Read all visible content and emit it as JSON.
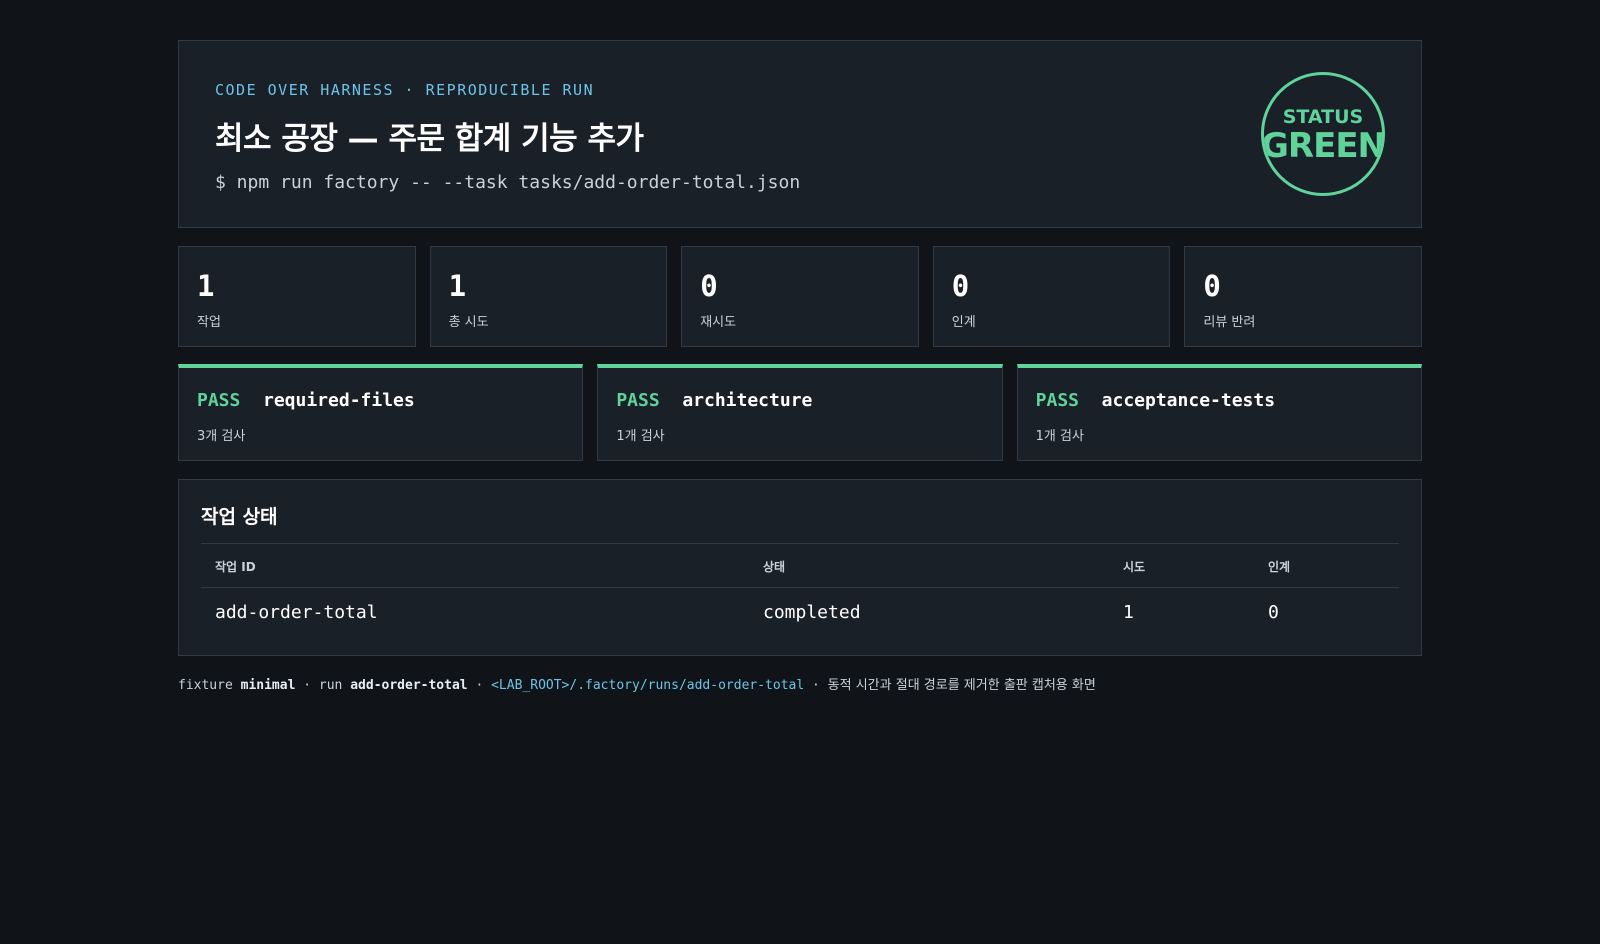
{
  "header": {
    "eyebrow": "CODE OVER HARNESS · REPRODUCIBLE RUN",
    "title": "최소 공장 — 주문 합계 기능 추가",
    "command": "$ npm run factory -- --task tasks/add-order-total.json",
    "status_label": "STATUS",
    "status_value": "GREEN"
  },
  "stats": [
    {
      "value": "1",
      "label": "작업"
    },
    {
      "value": "1",
      "label": "총 시도"
    },
    {
      "value": "0",
      "label": "재시도"
    },
    {
      "value": "0",
      "label": "인계"
    },
    {
      "value": "0",
      "label": "리뷰 반려"
    }
  ],
  "checks": [
    {
      "result": "PASS",
      "name": "required-files",
      "detail": "3개 검사"
    },
    {
      "result": "PASS",
      "name": "architecture",
      "detail": "1개 검사"
    },
    {
      "result": "PASS",
      "name": "acceptance-tests",
      "detail": "1개 검사"
    }
  ],
  "tasks": {
    "title": "작업 상태",
    "columns": [
      "작업 ID",
      "상태",
      "시도",
      "인계"
    ],
    "rows": [
      [
        "add-order-total",
        "completed",
        "1",
        "0"
      ]
    ]
  },
  "footer": {
    "fixture_prefix": "fixture",
    "fixture": "minimal",
    "run_prefix": "· run",
    "run": "add-order-total",
    "sep1": "·",
    "path": "<LAB_ROOT>/.factory/runs/add-order-total",
    "sep2": "·",
    "note": "동적 시간과 절대 경로를 제거한 출판 캡처용 화면"
  },
  "colors": {
    "background": "#101317",
    "panel": "#1a2028",
    "accent_green": "#5fd39a",
    "accent_blue": "#6cc4e8"
  }
}
